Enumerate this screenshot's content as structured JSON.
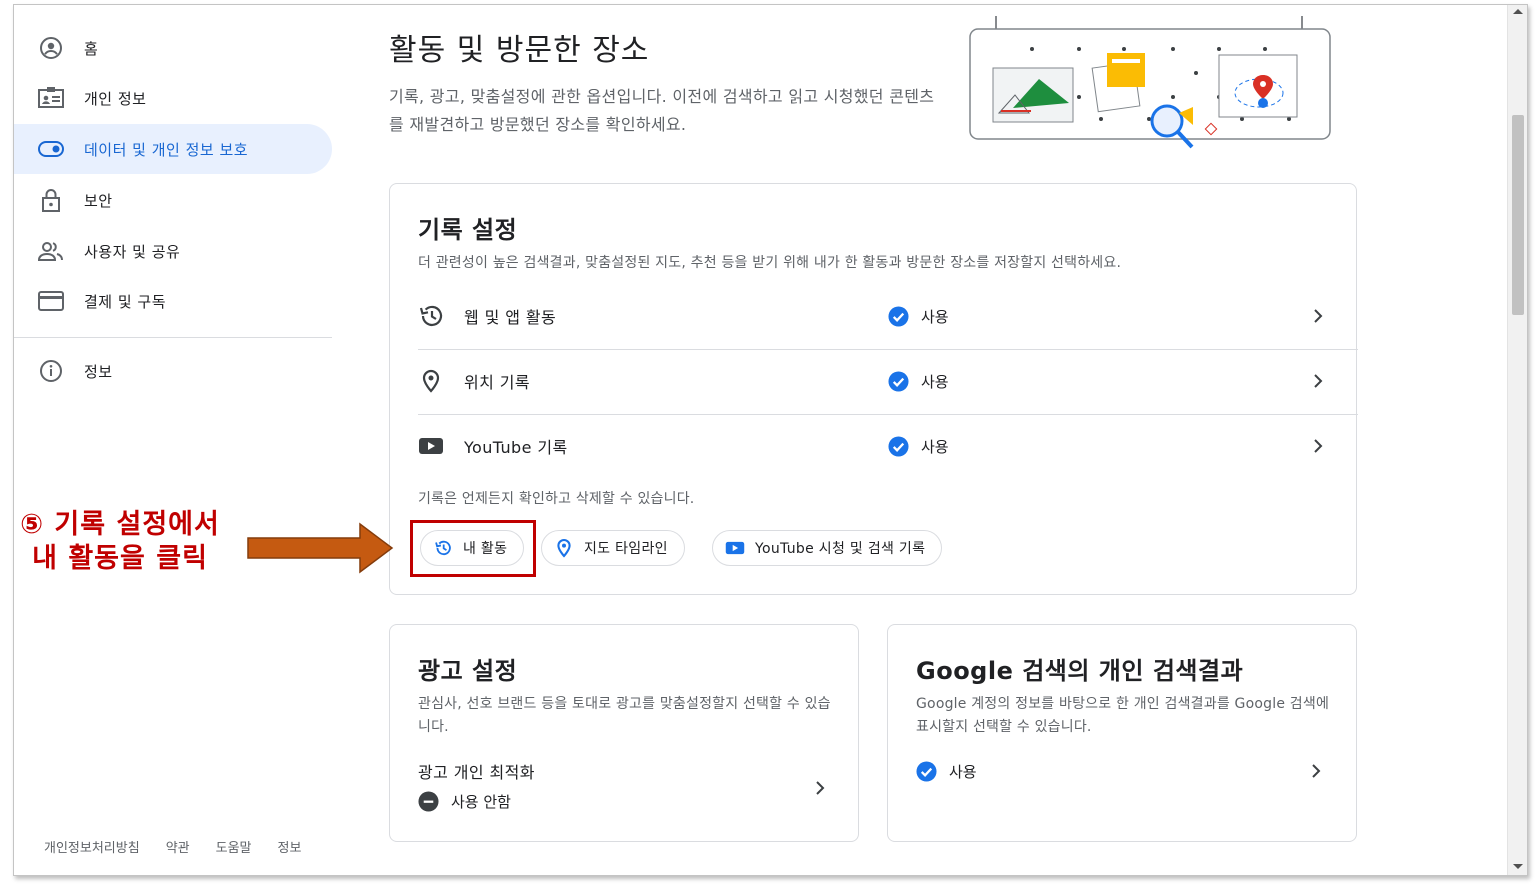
{
  "sidebar": {
    "items": [
      {
        "label": "홈",
        "icon": "account-circle-icon"
      },
      {
        "label": "개인 정보",
        "icon": "id-card-icon"
      },
      {
        "label": "데이터 및 개인 정보 보호",
        "icon": "toggle-icon",
        "active": true
      },
      {
        "label": "보안",
        "icon": "lock-icon"
      },
      {
        "label": "사용자 및 공유",
        "icon": "people-icon"
      },
      {
        "label": "결제 및 구독",
        "icon": "credit-card-icon"
      },
      {
        "label": "정보",
        "icon": "info-icon"
      }
    ],
    "footer": [
      "개인정보처리방침",
      "약관",
      "도움말",
      "정보"
    ]
  },
  "main": {
    "title": "활동 및 방문한 장소",
    "description": "기록, 광고, 맞춤설정에 관한 옵션입니다. 이전에 검색하고 읽고 시청했던 콘텐츠를 재발견하고 방문했던 장소를 확인하세요."
  },
  "history_card": {
    "title": "기록 설정",
    "subtitle": "더 관련성이 높은 검색결과, 맞춤설정된 지도, 추천 등을 받기 위해 내가 한 활동과 방문한 장소를 저장할지 선택하세요.",
    "rows": [
      {
        "name": "웹 및 앱 활동",
        "status": "사용",
        "icon": "history-icon"
      },
      {
        "name": "위치 기록",
        "status": "사용",
        "icon": "location-pin-icon"
      },
      {
        "name": "YouTube 기록",
        "status": "사용",
        "icon": "youtube-icon"
      }
    ],
    "note": "기록은 언제든지 확인하고 삭제할 수 있습니다.",
    "chips": [
      {
        "label": "내 활동",
        "icon": "history-icon"
      },
      {
        "label": "지도 타임라인",
        "icon": "location-pin-icon"
      },
      {
        "label": "YouTube 시청 및 검색 기록",
        "icon": "youtube-icon"
      }
    ]
  },
  "ads_card": {
    "title": "광고 설정",
    "subtitle": "관심사, 선호 브랜드 등을 토대로 광고를 맞춤설정할지 선택할 수 있습니다.",
    "item_label": "광고 개인 최적화",
    "item_status": "사용 안함"
  },
  "search_card": {
    "title": "Google 검색의 개인 검색결과",
    "subtitle": "Google 계정의 정보를 바탕으로 한 개인 검색결과를 Google 검색에 표시할지 선택할 수 있습니다.",
    "status": "사용"
  },
  "annotation": {
    "line1": "⑤ 기록 설정에서",
    "line2": "내 활동을 클릭"
  },
  "colors": {
    "accent_blue": "#1a73e8",
    "active_bg": "#e8f0fe",
    "annotation_red": "#c00000",
    "arrow_orange": "#c55a11"
  }
}
